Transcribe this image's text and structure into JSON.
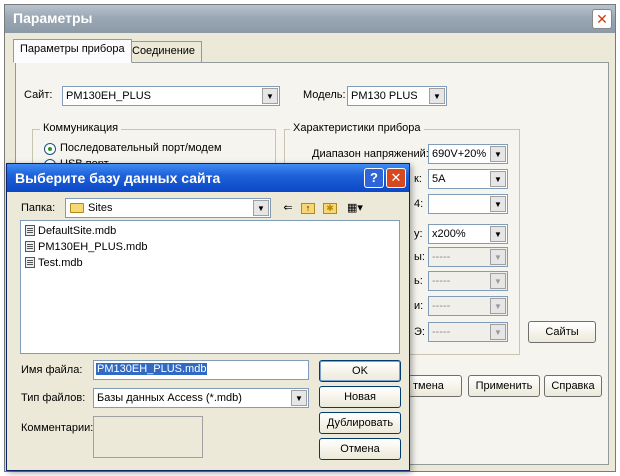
{
  "parent": {
    "title": "Параметры",
    "close_glyph": "✕",
    "tabs": [
      "Параметры прибора",
      "Соединение"
    ],
    "site_label": "Сайт:",
    "site_value": "PM130EH_PLUS",
    "model_label": "Модель:",
    "model_value": "PM130 PLUS",
    "comm_group_title": "Коммуникация",
    "comm_options": [
      "Последовательный порт/модем",
      "USB порт"
    ],
    "chars_group_title": "Характеристики прибора",
    "chars": [
      {
        "label": "Диапазон напряжений:",
        "value": "690V+20%"
      },
      {
        "label": "к:",
        "value": "5A"
      },
      {
        "label": "4:",
        "value": ""
      },
      {
        "label": "у:",
        "value": "x200%"
      },
      {
        "label": "ы:",
        "value": "-----"
      },
      {
        "label": "ь:",
        "value": "-----"
      },
      {
        "label": "и:",
        "value": "-----"
      },
      {
        "label": "Э:",
        "value": "-----"
      }
    ],
    "buttons": {
      "sites": "Сайты",
      "cancel_partial": "тмена",
      "apply": "Применить",
      "help": "Справка"
    }
  },
  "dialog": {
    "title": "Выберите базу данных сайта",
    "help_glyph": "?",
    "close_glyph": "✕",
    "folder_label": "Папка:",
    "folder_value": "Sites",
    "files": [
      "DefaultSite.mdb",
      "PM130EH_PLUS.mdb",
      "Test.mdb"
    ],
    "filename_label": "Имя файла:",
    "filename_value": "PM130EH_PLUS.mdb",
    "filetype_label": "Тип файлов:",
    "filetype_value": "Базы данных Access (*.mdb)",
    "comments_label": "Комментарии:",
    "buttons": {
      "ok": "OK",
      "new": "Новая",
      "duplicate": "Дублировать",
      "cancel": "Отмена"
    },
    "toolbar_icons": [
      "back-arrow-icon",
      "up-folder-icon",
      "new-folder-icon",
      "view-menu-icon"
    ]
  },
  "colors": {
    "dialog_title_bar": "#1f62d8",
    "parent_title_bar": "#9aa7b4",
    "selection": "#316ac5",
    "close_button": "#d8481e"
  }
}
